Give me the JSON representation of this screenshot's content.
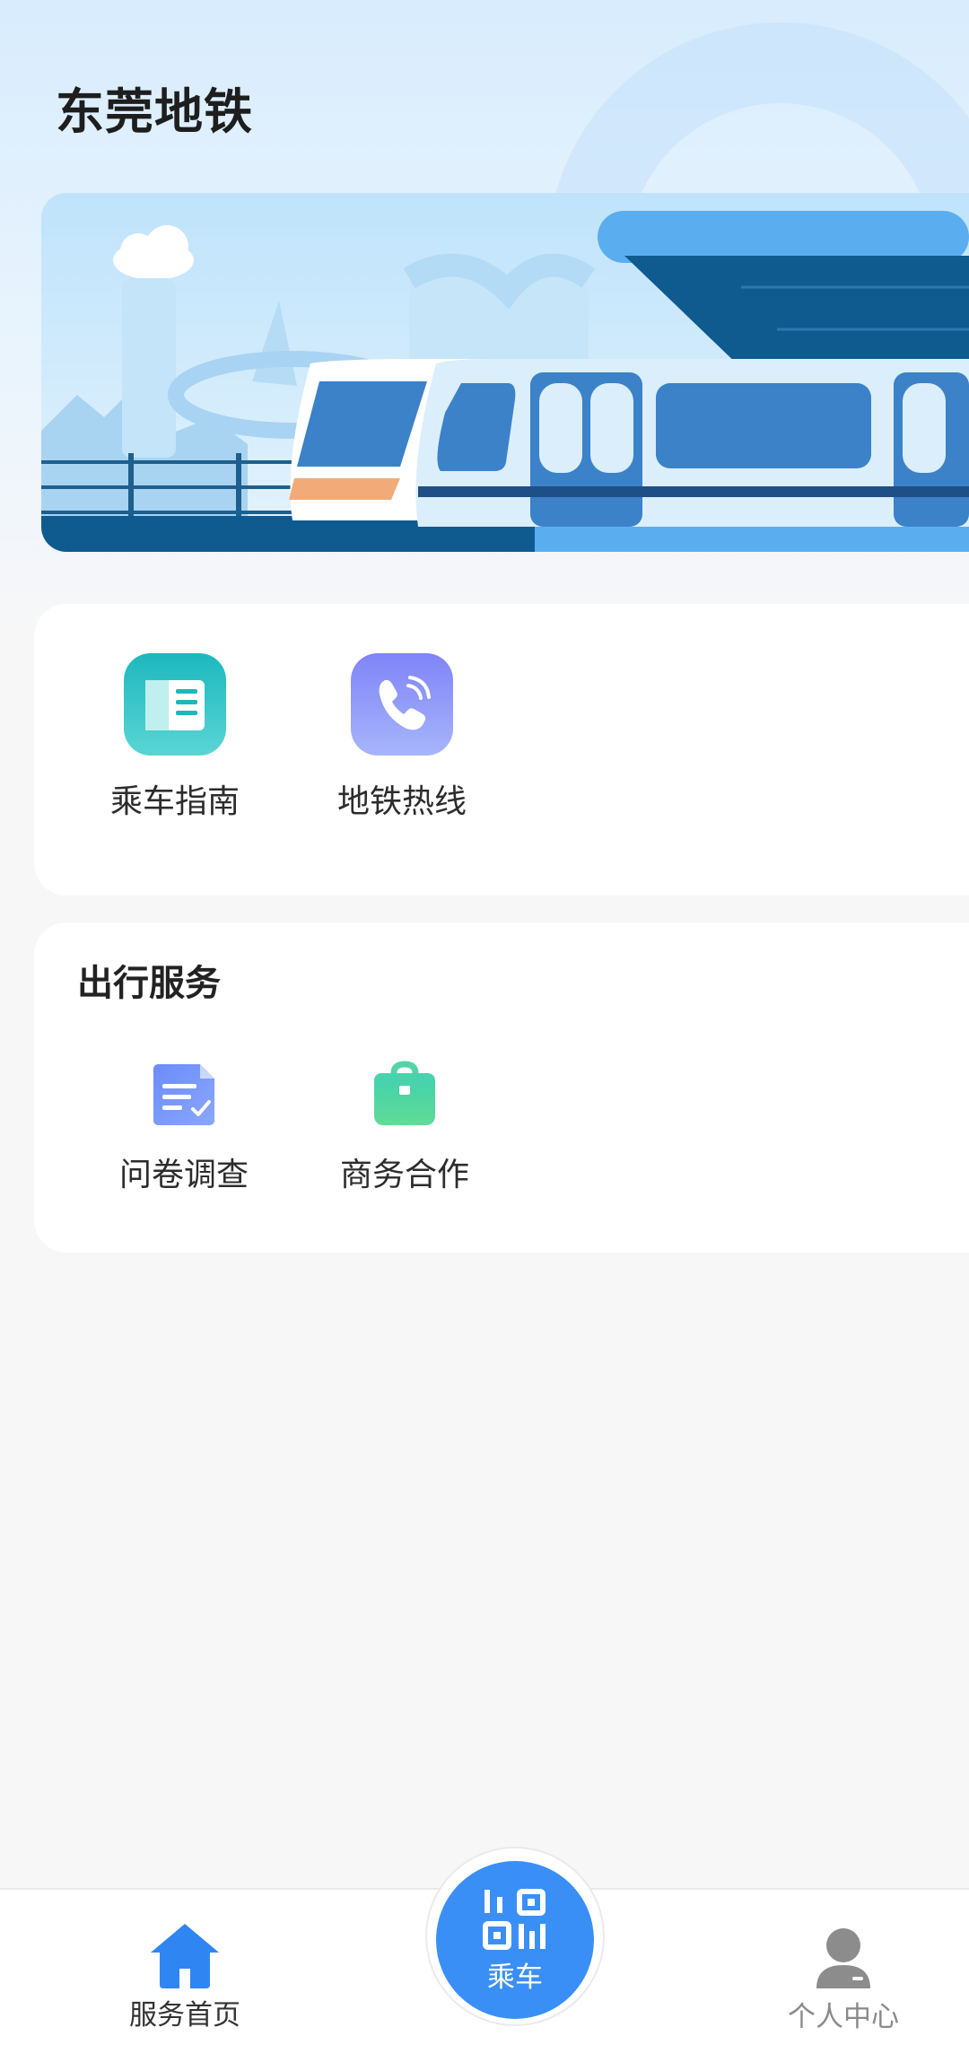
{
  "app": {
    "title": "东莞地铁"
  },
  "quick_links": [
    {
      "label": "乘车指南",
      "icon": "guide-book-icon",
      "color": "#2cc3c6"
    },
    {
      "label": "地铁热线",
      "icon": "hotline-phone-icon",
      "color": "#7e8dfa"
    }
  ],
  "travel_services": {
    "title": "出行服务",
    "items": [
      {
        "label": "问卷调查",
        "icon": "survey-document-icon",
        "color": "#6f8ffa"
      },
      {
        "label": "商务合作",
        "icon": "briefcase-icon",
        "color": "#4fd4a0"
      }
    ]
  },
  "tab_bar": {
    "home": {
      "label": "服务首页",
      "icon": "home-icon",
      "active": true
    },
    "ride": {
      "label": "乘车",
      "icon": "qr-code-icon"
    },
    "profile": {
      "label": "个人中心",
      "icon": "user-icon"
    }
  },
  "colors": {
    "accent": "#3a8ff6",
    "banner_dark": "#0f5a8f",
    "banner_light": "#5aaef0"
  }
}
